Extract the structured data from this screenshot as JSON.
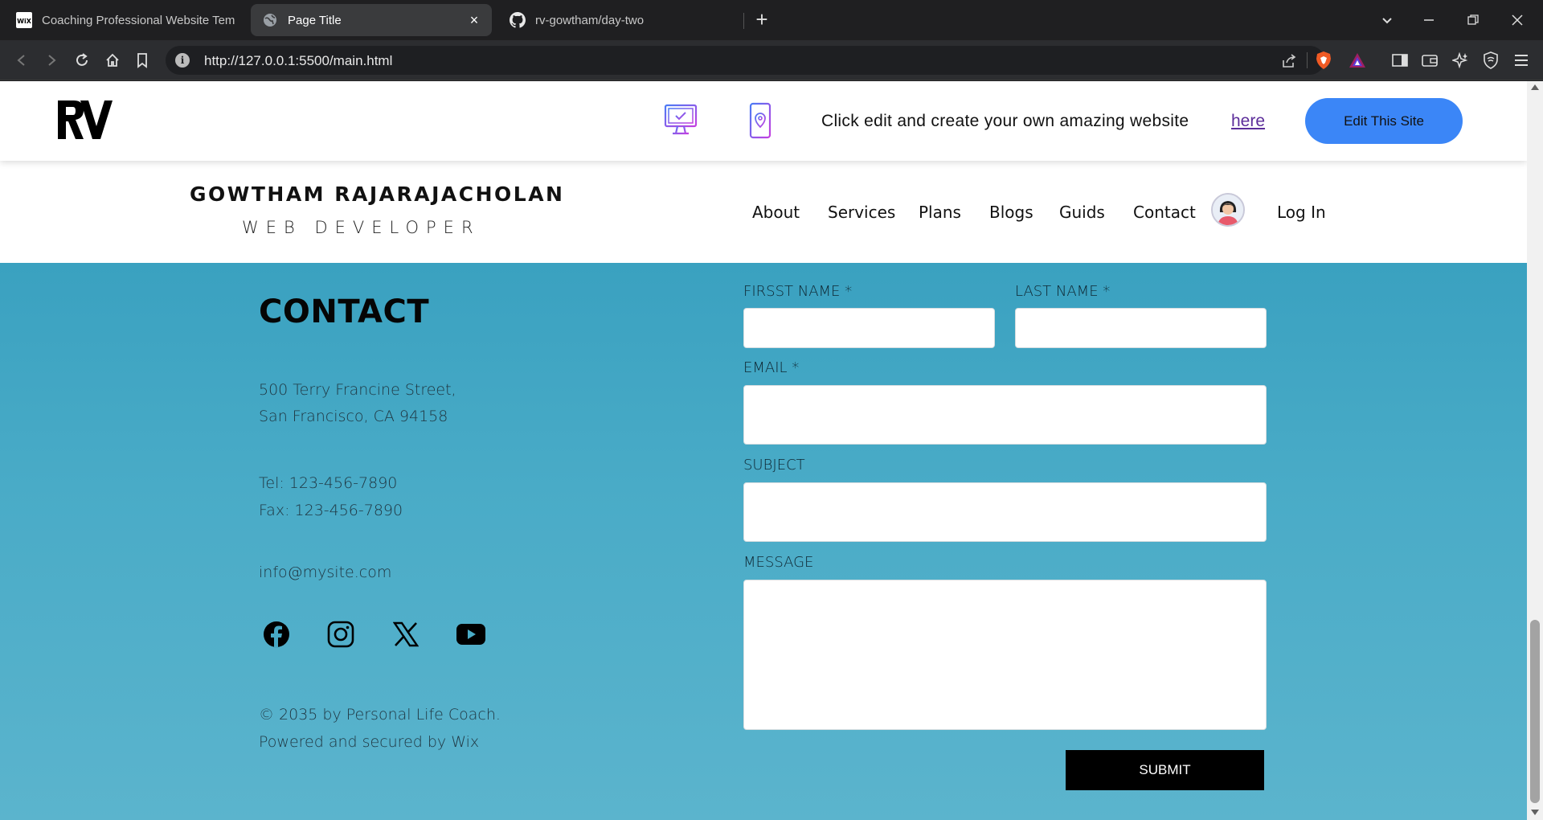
{
  "browser": {
    "tabs": [
      {
        "title": "Coaching Professional Website Templ",
        "favicon": "wix-favicon"
      },
      {
        "title": "Page Title",
        "favicon": "globe-icon",
        "active": true
      },
      {
        "title": "rv-gowtham/day-two",
        "favicon": "github-icon"
      }
    ],
    "close_glyph": "×",
    "new_tab_glyph": "+",
    "url": "http://127.0.0.1:5500/main.html"
  },
  "wix_banner": {
    "message": "Click edit and create your own amazing website",
    "link": "here",
    "edit_button": "Edit This Site"
  },
  "header": {
    "name": "GOWTHAM RAJARAJACHOLAN",
    "role": "WEB DEVELOPER",
    "nav": [
      "About",
      "Services",
      "Plans",
      "Blogs",
      "Guids",
      "Contact"
    ],
    "login": "Log In"
  },
  "contact": {
    "title": "CONTACT",
    "address_line1": "500 Terry Francine Street,",
    "address_line2": "San Francisco, CA 94158",
    "tel": "Tel: 123-456-7890",
    "fax": "Fax: 123-456-7890",
    "email": "info@mysite.com",
    "social": [
      "facebook-icon",
      "instagram-icon",
      "x-icon",
      "youtube-icon"
    ],
    "copyright_line1": "© 2035 by Personal Life Coach.",
    "copyright_line2": "Powered and secured by Wix"
  },
  "form": {
    "first_name_label": "FIRSST NAME *",
    "last_name_label": "LAST NAME *",
    "email_label": "EMAIL *",
    "subject_label": "SUBJECT",
    "message_label": "MESSAGE",
    "submit": "SUBMIT"
  },
  "colors": {
    "accent_button": "#3b86f7",
    "section_background": "#4aacc7",
    "link": "#5c2d9a"
  }
}
